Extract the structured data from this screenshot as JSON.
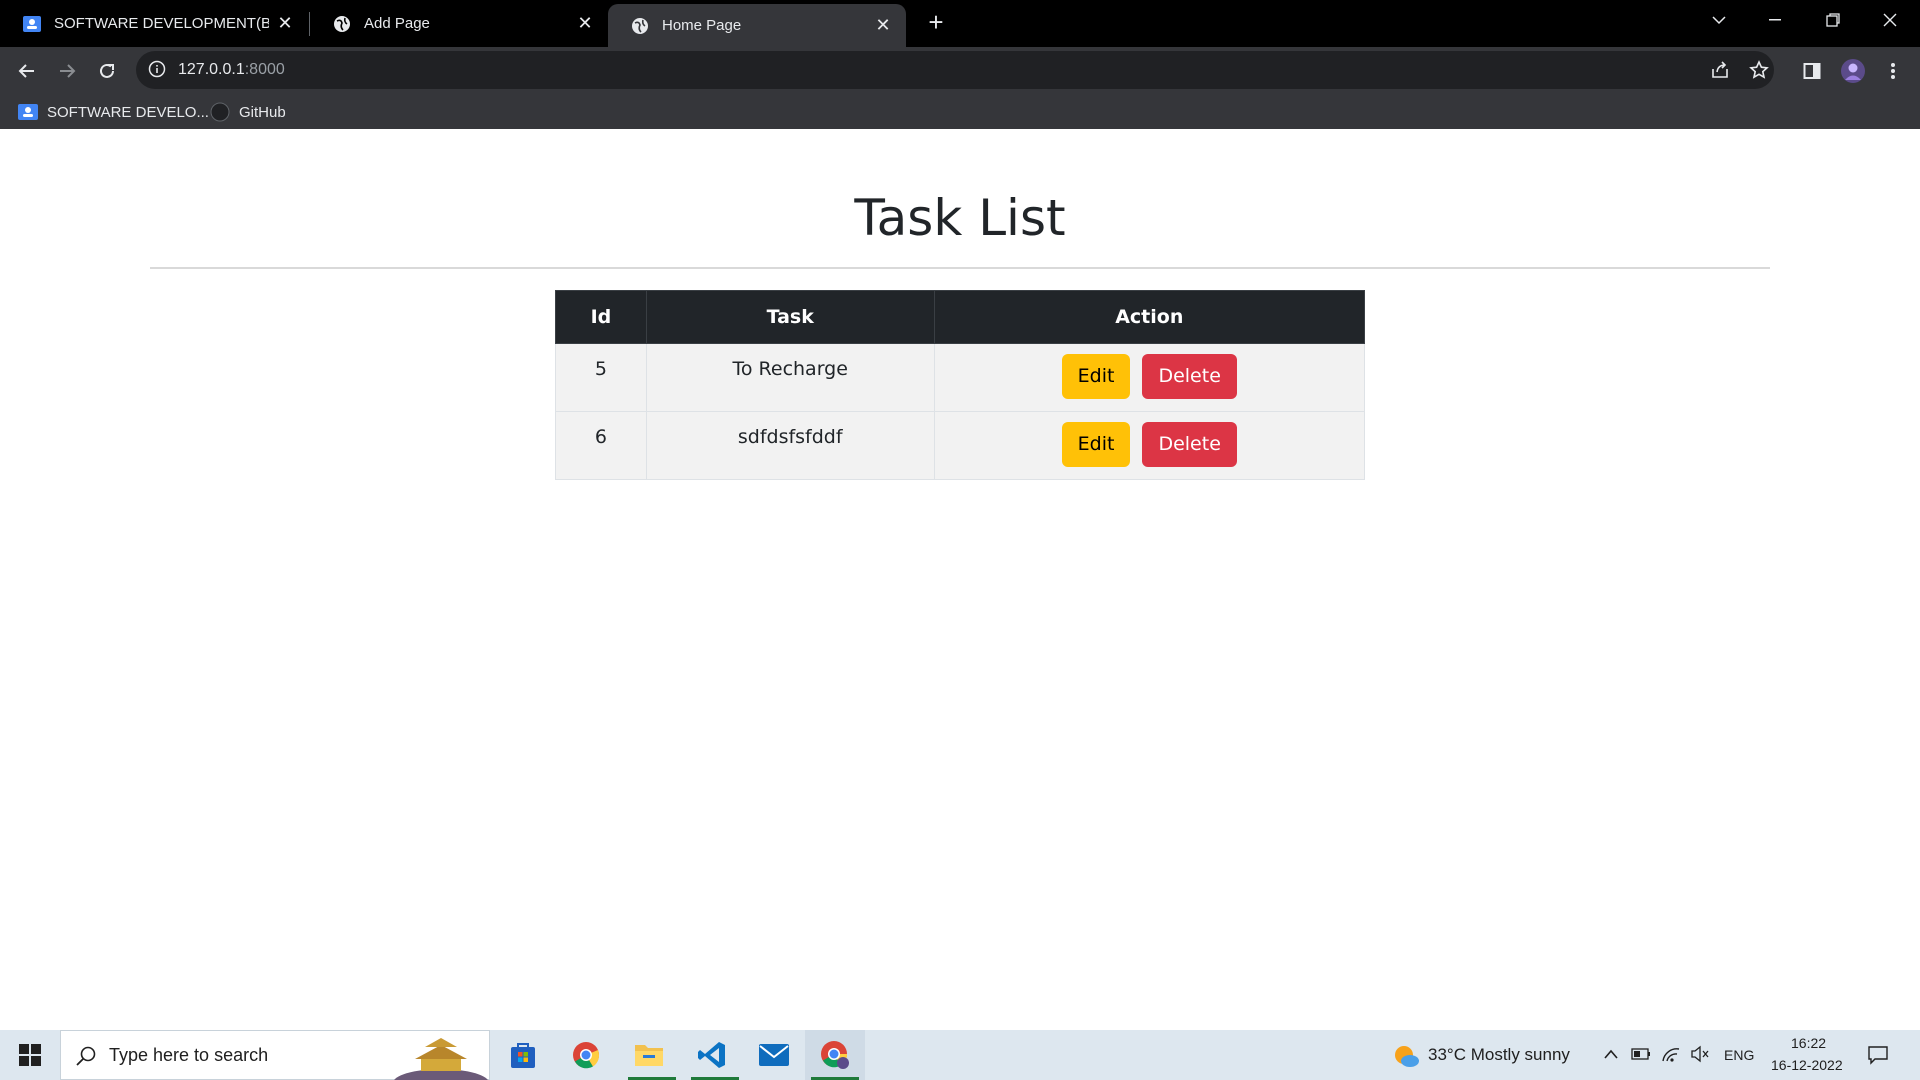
{
  "browser": {
    "tabs": [
      {
        "title": "SOFTWARE DEVELOPMENT(BATC",
        "icon": "classroom-icon",
        "active": false
      },
      {
        "title": "Add Page",
        "icon": "globe-icon",
        "active": false
      },
      {
        "title": "Home Page",
        "icon": "globe-icon",
        "active": true
      }
    ],
    "url_host": "127.0.0.1",
    "url_port": ":8000",
    "bookmarks": [
      {
        "label": "SOFTWARE DEVELO...",
        "icon": "classroom-icon"
      },
      {
        "label": "GitHub",
        "icon": "github-icon"
      }
    ]
  },
  "page": {
    "title": "Task List",
    "table": {
      "headers": [
        "Id",
        "Task",
        "Action"
      ],
      "rows": [
        {
          "id": "5",
          "task": "To Recharge",
          "edit_label": "Edit",
          "delete_label": "Delete"
        },
        {
          "id": "6",
          "task": "sdfdsfsfddf",
          "edit_label": "Edit",
          "delete_label": "Delete"
        }
      ]
    }
  },
  "taskbar": {
    "search_placeholder": "Type here to search",
    "weather": "33°C  Mostly sunny",
    "language": "ENG",
    "time": "16:22",
    "date": "16-12-2022"
  },
  "colors": {
    "edit_button": "#ffc107",
    "delete_button": "#dc3545",
    "table_header": "#212529"
  }
}
